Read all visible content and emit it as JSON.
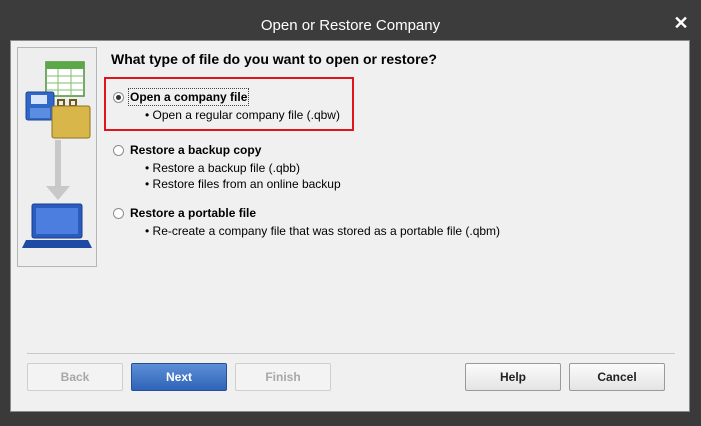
{
  "window": {
    "title": "Open or Restore Company",
    "close_icon": "close-icon"
  },
  "question": "What type of file do you want to open or restore?",
  "options": [
    {
      "label": "Open a company file",
      "selected": true,
      "bullets": [
        "Open a regular company file (.qbw)"
      ]
    },
    {
      "label": "Restore a backup copy",
      "selected": false,
      "bullets": [
        "Restore a backup file (.qbb)",
        "Restore files from an online backup"
      ]
    },
    {
      "label": "Restore a portable file",
      "selected": false,
      "bullets": [
        "Re-create a company file that was stored as a portable file (.qbm)"
      ]
    }
  ],
  "buttons": {
    "back": "Back",
    "next": "Next",
    "finish": "Finish",
    "help": "Help",
    "cancel": "Cancel"
  },
  "colors": {
    "highlight": "#e0151b",
    "primary_button": "#3a6fc4"
  }
}
